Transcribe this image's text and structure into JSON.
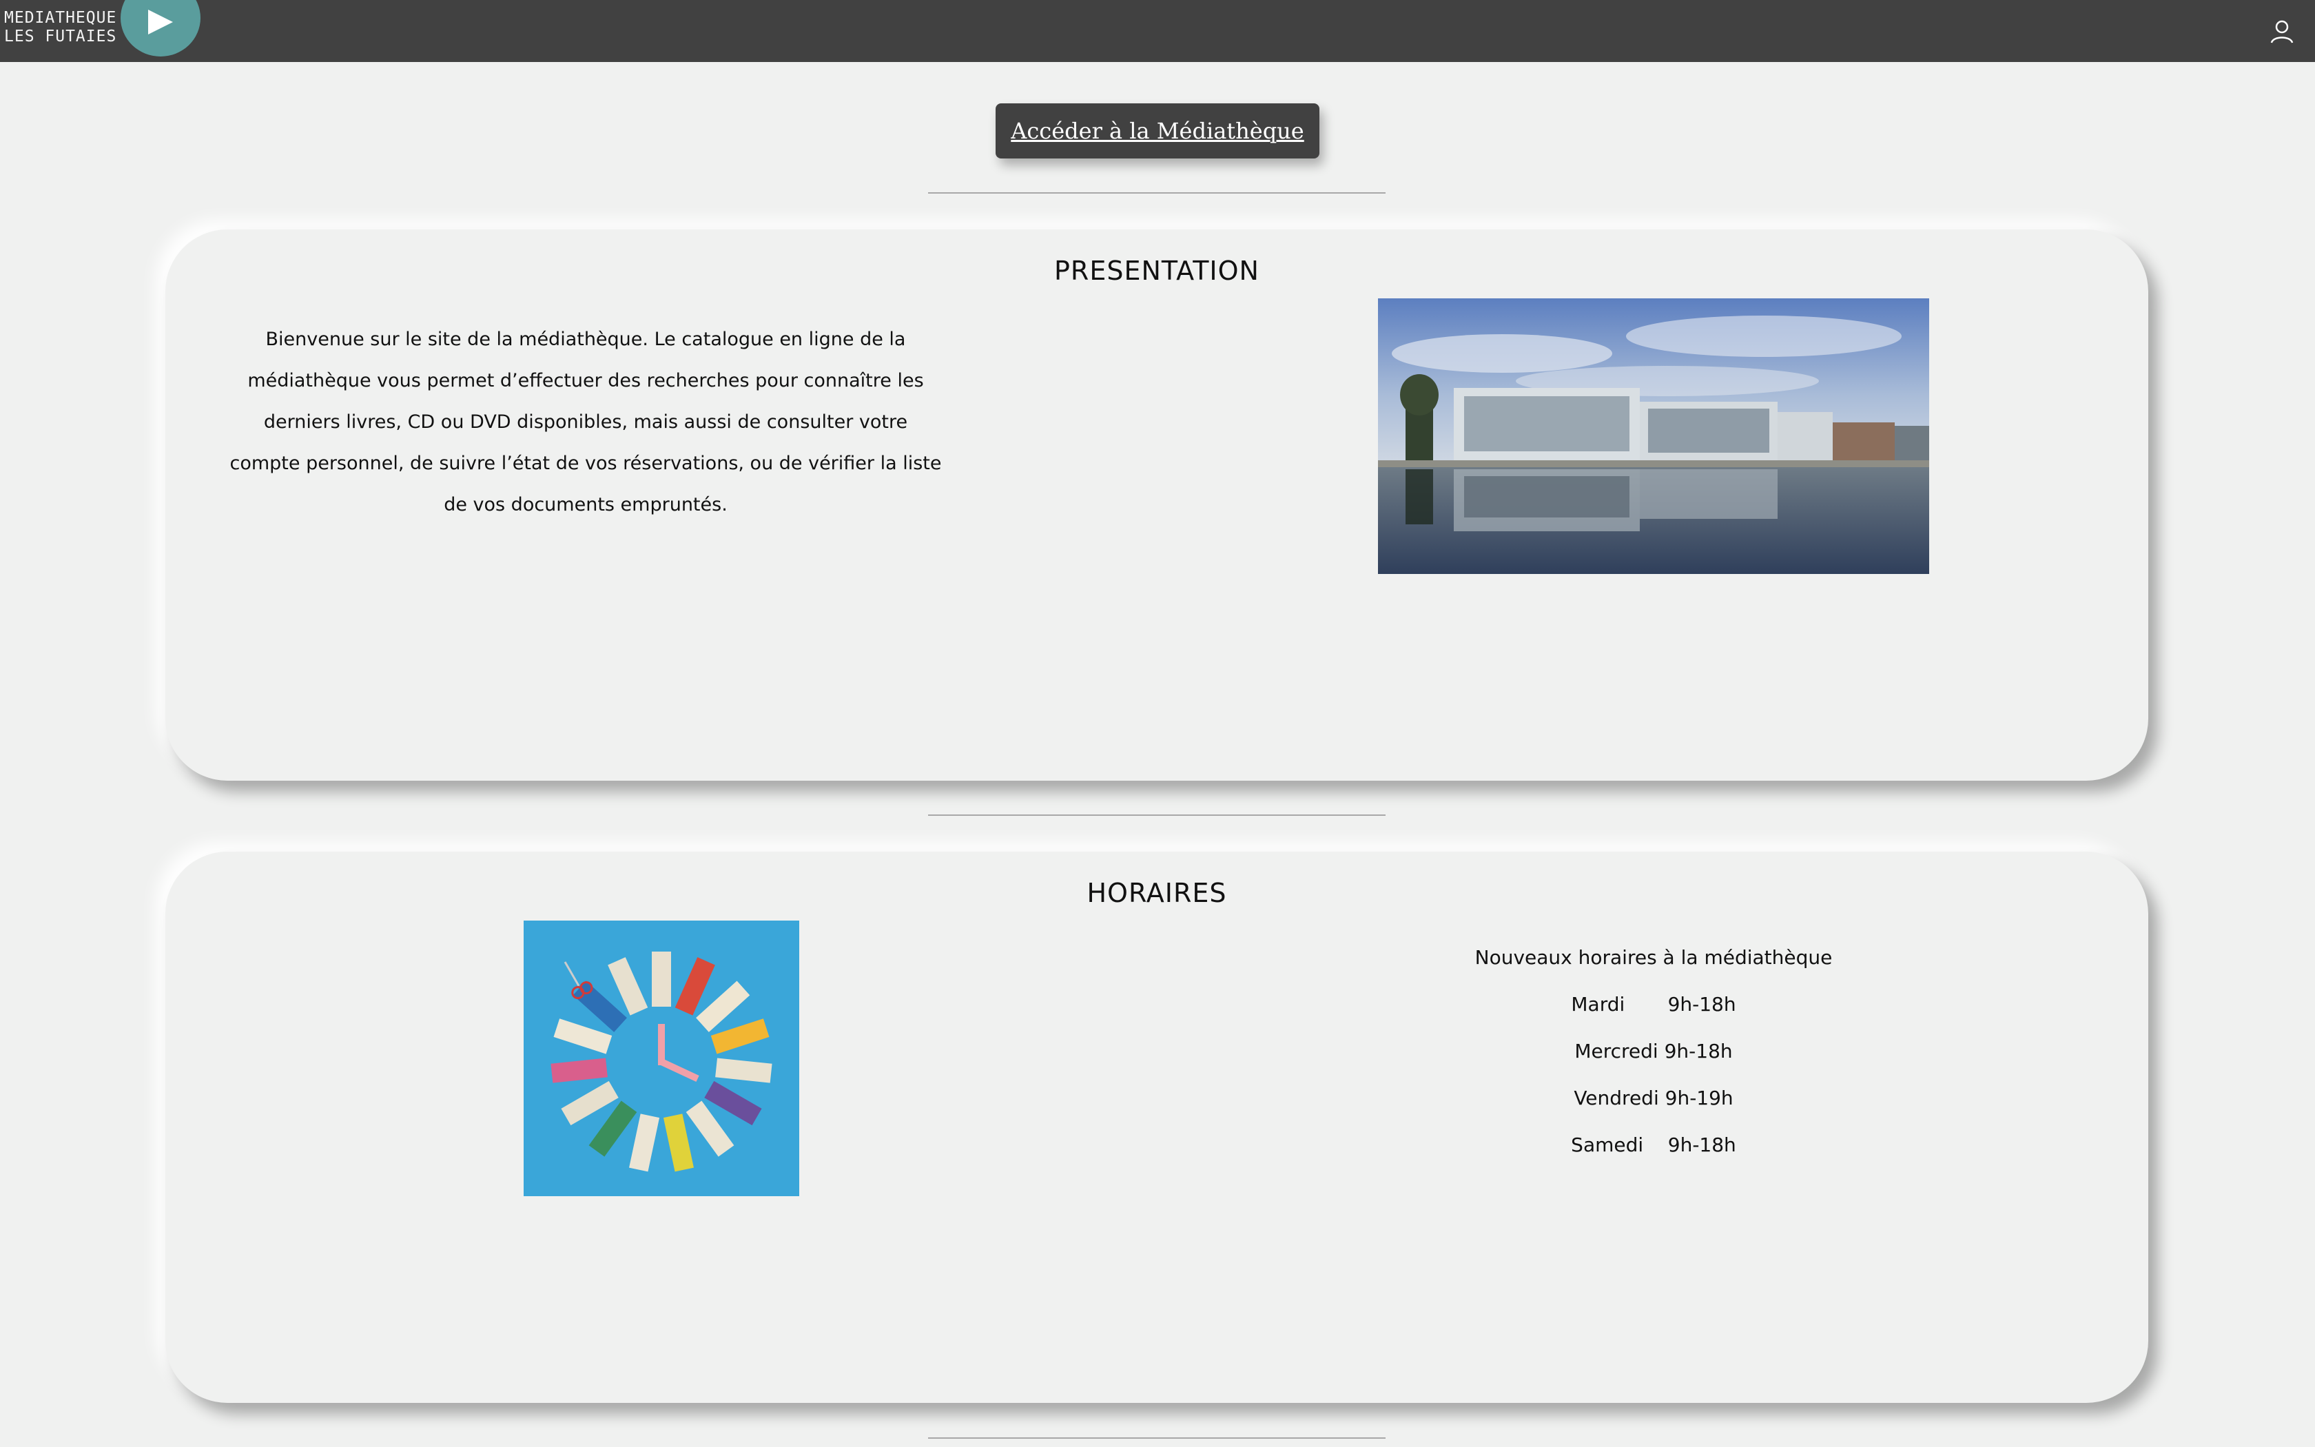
{
  "header": {
    "brand_line1": "MEDIATHEQUE",
    "brand_line2": "LES FUTAIES",
    "play_icon": "play-icon",
    "user_icon": "user-icon"
  },
  "access_button": {
    "label": "Accéder à la Médiathèque"
  },
  "presentation": {
    "title": "PRESENTATION",
    "text": "Bienvenue sur le site de la médiathèque. Le catalogue en ligne de la médiathèque vous permet d’effectuer des recherches pour connaître les derniers livres, CD ou DVD disponibles, mais aussi de consulter votre compte personnel, de suivre l’état de vos réservations, ou de vérifier la liste de vos documents empruntés."
  },
  "horaires": {
    "title": "HORAIRES",
    "intro": "Nouveaux horaires à la médiathèque",
    "lines": [
      "Mardi       9h-18h",
      "Mercredi 9h-18h",
      "Vendredi 9h-19h",
      "Samedi    9h-18h"
    ]
  },
  "colors": {
    "topbar": "#414141",
    "accent_teal": "#5a9d9d",
    "background": "#f0f1f0",
    "button": "#414141"
  }
}
